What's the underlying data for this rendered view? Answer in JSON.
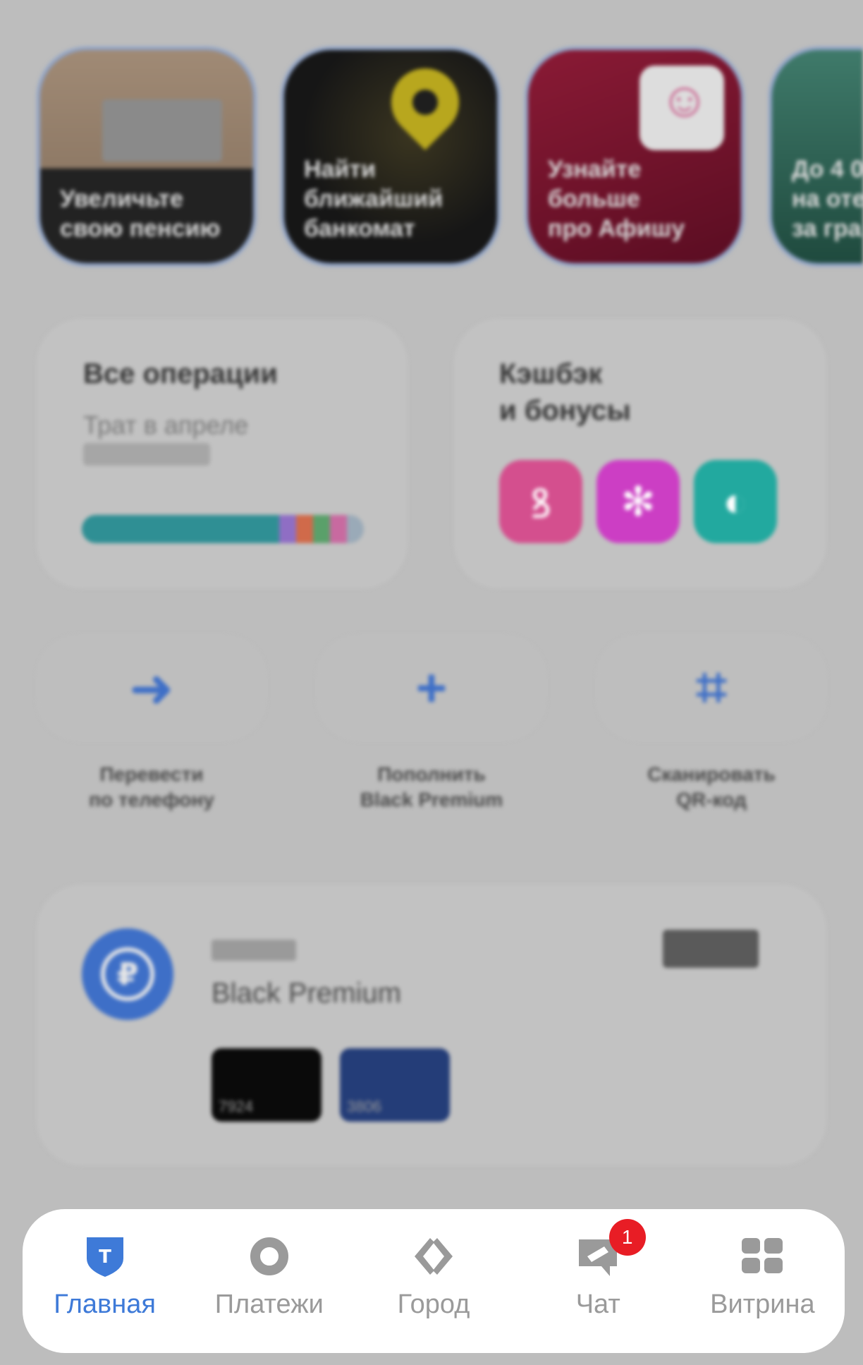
{
  "stories": [
    {
      "caption": "Увеличьте\nсвою пенсию"
    },
    {
      "caption": "Найти\nближайший\nбанкомат"
    },
    {
      "caption": "Узнайте\nбольше\nпро Афишу"
    },
    {
      "caption": "До 4 0\nна оте\nза гра"
    }
  ],
  "operations": {
    "title": "Все операции",
    "subtitle": "Трат в апреле",
    "bar_colors": [
      "#2f8f94",
      "#8f6ec4",
      "#d06a4a",
      "#5aa06a",
      "#c86aa0",
      "#9aaab8"
    ],
    "bar_fractions": [
      0.7,
      0.06,
      0.06,
      0.06,
      0.06,
      0.06
    ]
  },
  "cashback": {
    "title": "Кэшбэк\nи бонусы",
    "icons": [
      {
        "name": "ribbon-icon",
        "glyph": "ꝸ",
        "color": "#d44f8e"
      },
      {
        "name": "butterfly-icon",
        "glyph": "✻",
        "color": "#cc3ec4"
      },
      {
        "name": "compass-icon",
        "glyph": "◐",
        "color": "#22a99f"
      }
    ]
  },
  "quick_actions": [
    {
      "label": "Перевести\nпо телефону",
      "glyph": "➜"
    },
    {
      "label": "Пополнить\nBlack Premium",
      "glyph": "+"
    },
    {
      "label": "Сканировать\nQR-код",
      "glyph": "⌗"
    }
  ],
  "account": {
    "name": "Black Premium",
    "currency_symbol": "₽",
    "cards": [
      {
        "last4": "7924"
      },
      {
        "last4": "3806"
      }
    ]
  },
  "tabbar": {
    "tabs": [
      {
        "label": "Главная",
        "active": true
      },
      {
        "label": "Платежи",
        "active": false
      },
      {
        "label": "Город",
        "active": false
      },
      {
        "label": "Чат",
        "active": false,
        "badge": "1"
      },
      {
        "label": "Витрина",
        "active": false
      }
    ]
  },
  "colors": {
    "accent": "#3e7ad8",
    "badge": "#e81d25"
  }
}
